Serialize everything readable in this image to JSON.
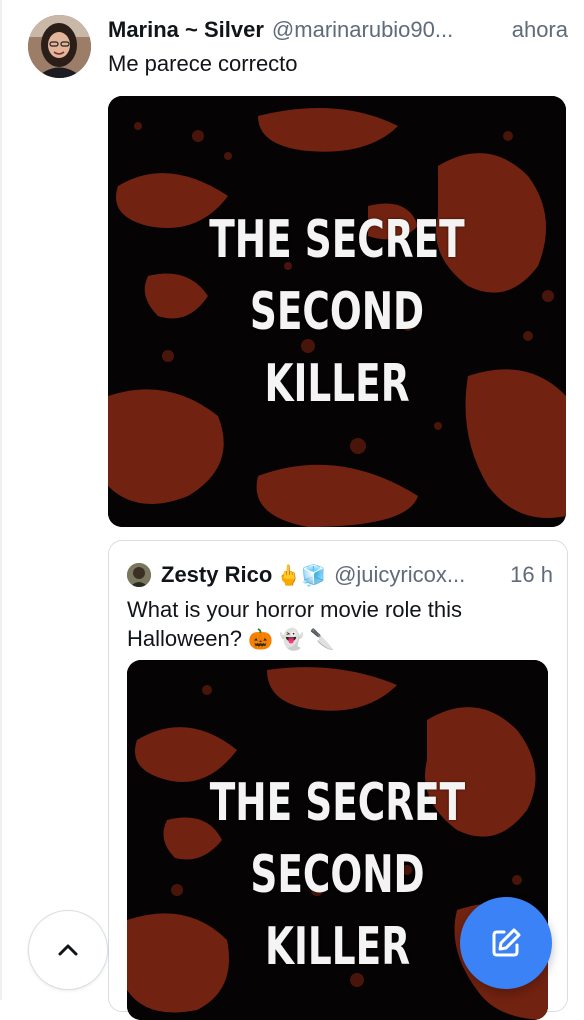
{
  "post": {
    "author_name": "Marina ~ Silver",
    "handle": "@marinarubio90...",
    "time": "ahora",
    "text": "Me parece correcto",
    "media_title_line1": "THE SECRET",
    "media_title_line2": "SECOND KILLER"
  },
  "quote": {
    "author_name": "Zesty Rico",
    "badge_emojis": "🖕🧊",
    "handle": "@juicyricox...",
    "time": "16 h",
    "text": "What is your horror movie role this Halloween?",
    "text_emojis": "🎃👻🔪",
    "media_title_line1": "THE SECRET",
    "media_title_line2": "SECOND KILLER"
  },
  "icons": {
    "scroll_top": "chevron-up-icon",
    "compose": "pencil-square-icon"
  },
  "colors": {
    "accent": "#3b82f6",
    "blood": "#8a2a14",
    "muted_text": "#5f6b7a"
  }
}
